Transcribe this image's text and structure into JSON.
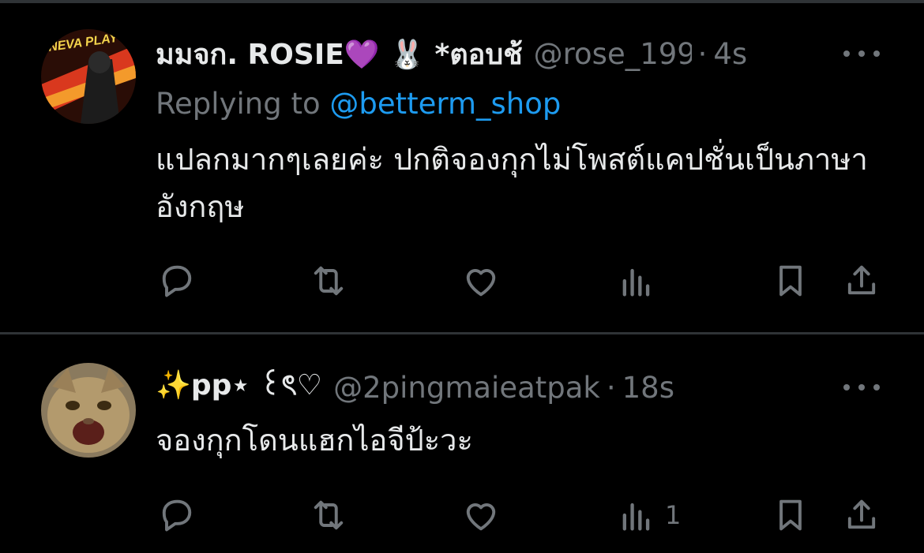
{
  "tweets": [
    {
      "author_name": "มมจก. ROSIE💜 🐰 *ตอบช้",
      "handle": "@rose_199",
      "separator": "·",
      "time": "4s",
      "replying_label": "Replying to ",
      "replying_to": "@betterm_shop",
      "text": "แปลกมากๆเลยค่ะ ปกติจองกุกไม่โพสต์แคปชั่นเป็นภาษาอังกฤษ",
      "avatar_logo": "NEVA PLAY",
      "views": ""
    },
    {
      "author_name": "✨pp⋆ ꒰ৎ♡",
      "handle": "@2pingmaieatpak",
      "separator": "·",
      "time": "18s",
      "text": "จองกุกโดนแฮกไอจีป้ะวะ",
      "views": "1"
    }
  ],
  "icons": [
    "reply-icon",
    "retweet-icon",
    "like-icon",
    "views-icon",
    "bookmark-icon",
    "share-icon",
    "more-icon"
  ],
  "colors": {
    "background": "#000000",
    "text": "#e7e9ea",
    "muted": "#71767b",
    "link": "#1d9bf0",
    "divider": "#2f3336"
  }
}
